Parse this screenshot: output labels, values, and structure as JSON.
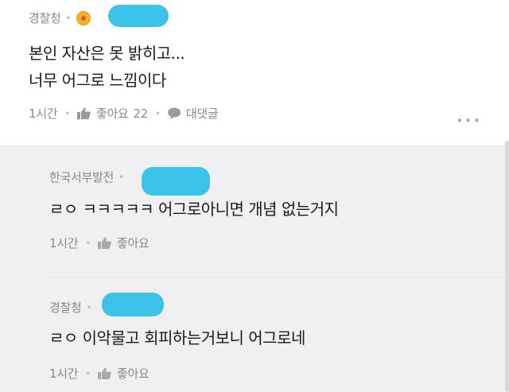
{
  "comment": {
    "author": "경찰청",
    "lines": [
      "본인 자산은 못 밝히고...",
      "너무 어그로 느낌이다"
    ],
    "time": "1시간",
    "like_label": "좋아요",
    "like_count": "22",
    "reply_label": "대댓글",
    "more": "•••"
  },
  "replies": [
    {
      "author": "한국서부발전",
      "text": "ㄹㅇ ㅋㅋㅋㅋㅋ 어그로아니면 개념 없는거지",
      "time": "1시간",
      "like_label": "좋아요"
    },
    {
      "author": "경찰청",
      "text": "ㄹㅇ 이악물고 회피하는거보니 어그로네",
      "time": "1시간",
      "like_label": "좋아요"
    }
  ],
  "colors": {
    "redaction": "#3cc3ea",
    "reply_bg": "#f0f0f2",
    "badge": "#f4b22a"
  },
  "icons": {
    "like": "thumbs-up-icon",
    "reply": "speech-bubble-icon",
    "more": "more-dots-icon"
  }
}
